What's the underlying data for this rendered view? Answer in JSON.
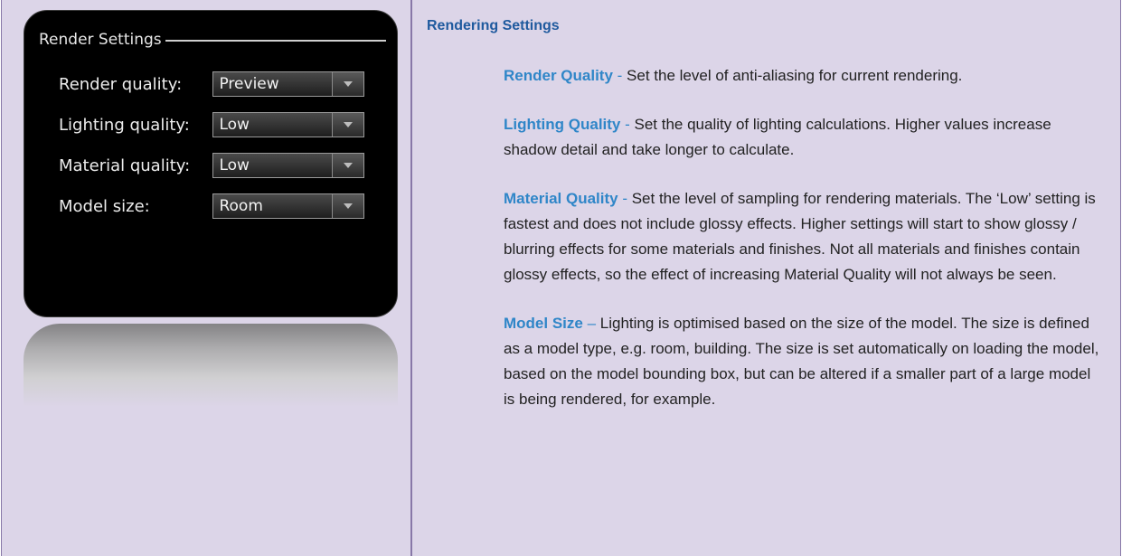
{
  "panel": {
    "title": "Render Settings",
    "rows": [
      {
        "label": "Render quality:",
        "value": "Preview"
      },
      {
        "label": "Lighting quality:",
        "value": "Low"
      },
      {
        "label": "Material quality:",
        "value": "Low"
      },
      {
        "label": "Model size:",
        "value": "Room"
      }
    ]
  },
  "help": {
    "title": "Rendering Settings",
    "items": [
      {
        "term": "Render Quality",
        "separator": " - ",
        "text": "Set the level of anti-aliasing for current rendering."
      },
      {
        "term": "Lighting Quality",
        "separator": " - ",
        "text": "Set the quality of lighting calculations. Higher values increase shadow detail and take longer to calculate."
      },
      {
        "term": "Material Quality",
        "separator": " - ",
        "text": "Set the level of sampling for rendering materials. The ‘Low’ setting is fastest and does not include glossy effects. Higher settings will start to show glossy / blurring effects for some materials and finishes. Not all materials and finishes contain glossy effects, so the effect of increasing Material Quality will not always be seen."
      },
      {
        "term": "Model Size",
        "separator": " – ",
        "text": "Lighting is optimised based on the size of the model. The size is defined as a model type, e.g. room, building. The size is set automatically on loading the model, based on the model bounding box, but can be altered if a smaller part of a large model is being rendered, for example."
      }
    ]
  },
  "colors": {
    "background": "#dcd5e8",
    "border": "#8878a8",
    "title": "#1f5a9e",
    "term": "#2f86c8"
  },
  "icons": {
    "dropdown": "chevron-down-icon"
  }
}
